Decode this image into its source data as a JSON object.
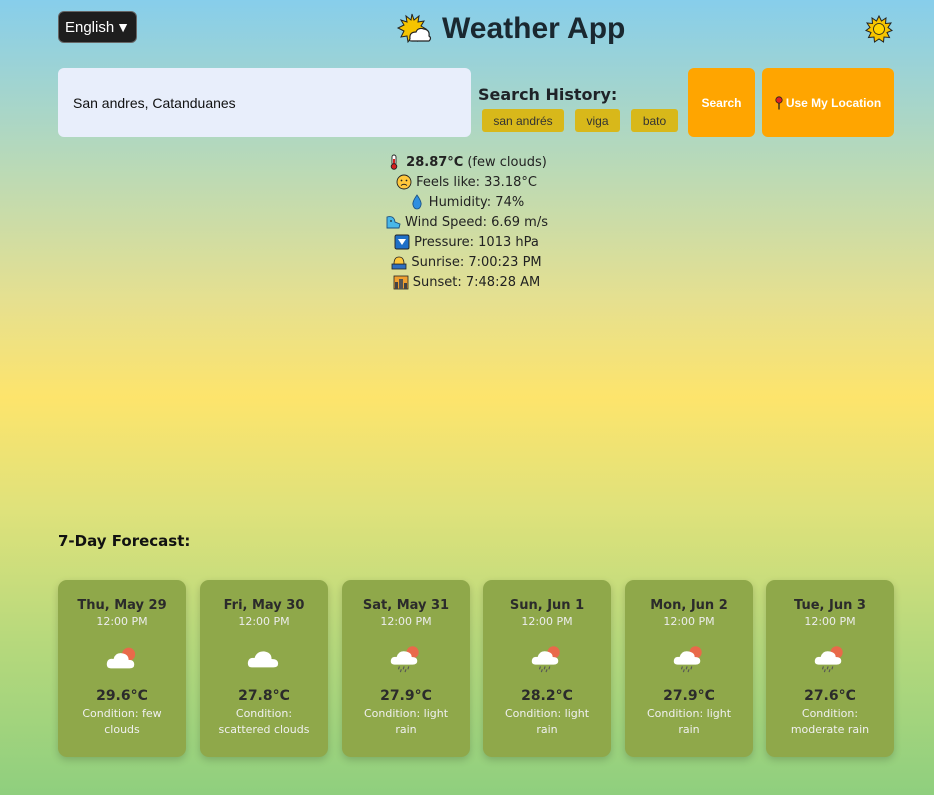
{
  "header": {
    "language": "English",
    "title": "Weather App"
  },
  "search": {
    "value": "San andres, Catanduanes",
    "history_title": "Search History:",
    "history": [
      "san andrés",
      "viga",
      "bato"
    ],
    "search_label": "Search",
    "location_label": "Use My Location"
  },
  "current": {
    "temp": "28.87°C",
    "condition": "(few clouds)",
    "feels_like": "Feels like: 33.18°C",
    "humidity": "Humidity: 74%",
    "wind": "Wind Speed: 6.69 m/s",
    "pressure": "Pressure: 1013 hPa",
    "sunrise": "Sunrise: 7:00:23 PM",
    "sunset": "Sunset: 7:48:28 AM"
  },
  "forecast": {
    "title": "7-Day Forecast:",
    "days": [
      {
        "day": "Thu, May 29",
        "time": "12:00 PM",
        "temp": "29.6°C",
        "condition": "Condition: few clouds",
        "icon": "few-clouds-icon"
      },
      {
        "day": "Fri, May 30",
        "time": "12:00 PM",
        "temp": "27.8°C",
        "condition": "Condition: scattered clouds",
        "icon": "cloud-icon"
      },
      {
        "day": "Sat, May 31",
        "time": "12:00 PM",
        "temp": "27.9°C",
        "condition": "Condition: light rain",
        "icon": "rain-icon"
      },
      {
        "day": "Sun, Jun 1",
        "time": "12:00 PM",
        "temp": "28.2°C",
        "condition": "Condition: light rain",
        "icon": "rain-icon"
      },
      {
        "day": "Mon, Jun 2",
        "time": "12:00 PM",
        "temp": "27.9°C",
        "condition": "Condition: light rain",
        "icon": "rain-icon"
      },
      {
        "day": "Tue, Jun 3",
        "time": "12:00 PM",
        "temp": "27.6°C",
        "condition": "Condition: moderate rain",
        "icon": "rain-icon"
      }
    ]
  },
  "colors": {
    "accent": "#ffa500",
    "chip": "#d8b81a",
    "card": "#8fa84a"
  }
}
